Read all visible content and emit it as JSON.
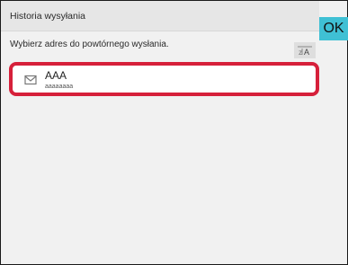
{
  "header": {
    "title": "Historia wysyłania"
  },
  "ok_button": {
    "label": "OK"
  },
  "instruction": "Wybierz adres do powtórnego wysłania.",
  "sort_button": {
    "icon": "sort-az-icon"
  },
  "history_list": [
    {
      "icon": "mail-icon",
      "name": "AAA",
      "address": "aaaaaaaa",
      "selected": true
    }
  ],
  "colors": {
    "accent": "#3fc0d4",
    "selection_border": "#d6203a",
    "background": "#f1f1f1"
  }
}
